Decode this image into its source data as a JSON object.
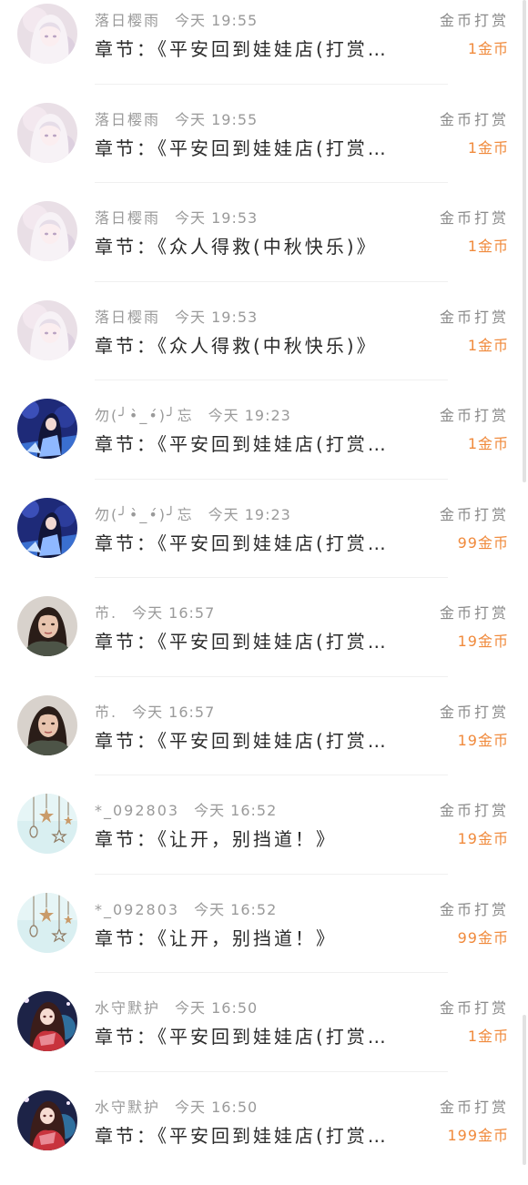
{
  "records": [
    {
      "avatar": "pastel-anime-girl-avatar",
      "name": "落日樱雨",
      "time": "今天  19:55",
      "chapter": "章节：《平安回到娃娃店(打赏…",
      "type": "金币打赏",
      "amount": "1金币"
    },
    {
      "avatar": "pastel-anime-girl-avatar",
      "name": "落日樱雨",
      "time": "今天  19:55",
      "chapter": "章节：《平安回到娃娃店(打赏…",
      "type": "金币打赏",
      "amount": "1金币"
    },
    {
      "avatar": "pastel-anime-girl-avatar",
      "name": "落日樱雨",
      "time": "今天  19:53",
      "chapter": "章节：《众人得救(中秋快乐)》",
      "type": "金币打赏",
      "amount": "1金币"
    },
    {
      "avatar": "pastel-anime-girl-avatar",
      "name": "落日樱雨",
      "time": "今天  19:53",
      "chapter": "章节：《众人得救(中秋快乐)》",
      "type": "金币打赏",
      "amount": "1金币"
    },
    {
      "avatar": "blue-anime-girl-avatar",
      "name": "勿(╯•̀_•́)╯忘",
      "time": "今天  19:23",
      "chapter": "章节：《平安回到娃娃店(打赏…",
      "type": "金币打赏",
      "amount": "1金币"
    },
    {
      "avatar": "blue-anime-girl-avatar",
      "name": "勿(╯•̀_•́)╯忘",
      "time": "今天  19:23",
      "chapter": "章节：《平安回到娃娃店(打赏…",
      "type": "金币打赏",
      "amount": "99金币"
    },
    {
      "avatar": "woman-photo-avatar",
      "name": "芇.",
      "time": "今天  16:57",
      "chapter": "章节：《平安回到娃娃店(打赏…",
      "type": "金币打赏",
      "amount": "19金币"
    },
    {
      "avatar": "woman-photo-avatar",
      "name": "芇.",
      "time": "今天  16:57",
      "chapter": "章节：《平安回到娃娃店(打赏…",
      "type": "金币打赏",
      "amount": "19金币"
    },
    {
      "avatar": "hanging-stars-avatar",
      "name": "*_092803",
      "time": "今天  16:52",
      "chapter": "章节：《让开，别挡道！》",
      "type": "金币打赏",
      "amount": "19金币"
    },
    {
      "avatar": "hanging-stars-avatar",
      "name": "*_092803",
      "time": "今天  16:52",
      "chapter": "章节：《让开，别挡道！》",
      "type": "金币打赏",
      "amount": "99金币"
    },
    {
      "avatar": "red-anime-girl-avatar",
      "name": "水守默护",
      "time": "今天  16:50",
      "chapter": "章节：《平安回到娃娃店(打赏…",
      "type": "金币打赏",
      "amount": "1金币"
    },
    {
      "avatar": "red-anime-girl-avatar",
      "name": "水守默护",
      "time": "今天  16:50",
      "chapter": "章节：《平安回到娃娃店(打赏…",
      "type": "金币打赏",
      "amount": "199金币"
    }
  ],
  "colors": {
    "amount": "#f08a3c",
    "name": "#9a9a9a",
    "chapter": "#2a2a2a"
  }
}
